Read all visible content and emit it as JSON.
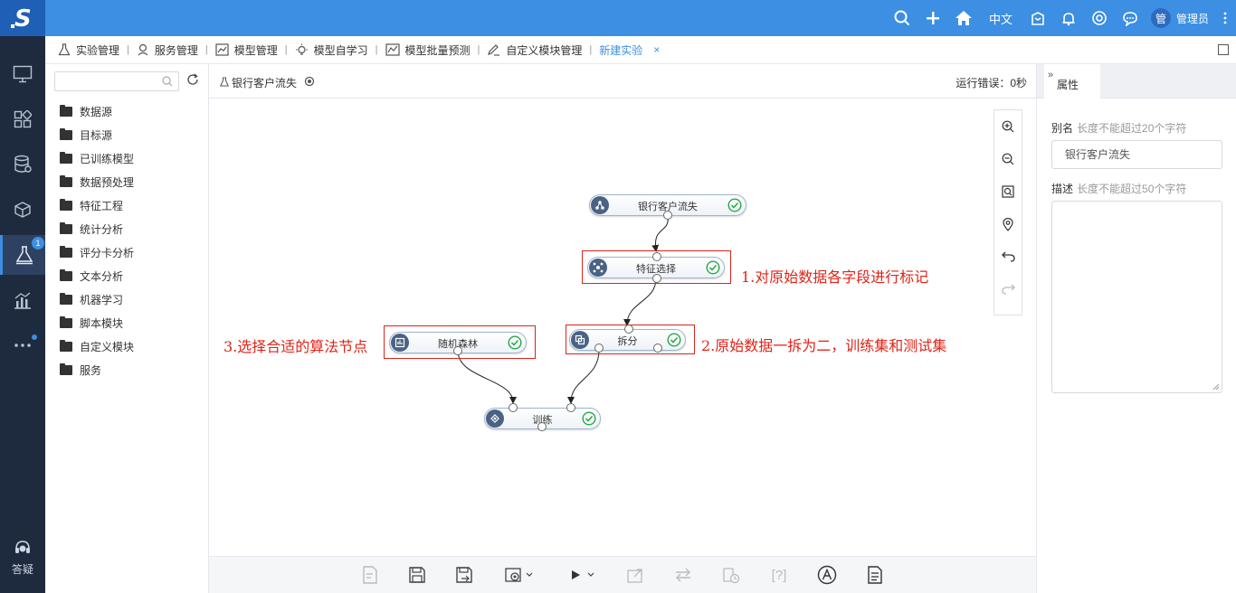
{
  "header": {
    "lang_label": "中文",
    "avatar_text": "管",
    "user_name": "管理员",
    "icons": [
      "search-icon",
      "plus-icon",
      "home-icon",
      "package-icon",
      "bell-icon",
      "life-ring-icon",
      "chat-icon",
      "more-vertical-icon"
    ]
  },
  "rail": {
    "items": [
      "monitor-icon",
      "dashboard-icon",
      "database-icon",
      "cube-icon",
      "experiment-icon",
      "chart-icon",
      "more-icon"
    ],
    "badge": "1",
    "help_label": "答疑"
  },
  "tabs": [
    {
      "label": "实验管理",
      "icon": "flask-icon"
    },
    {
      "label": "服务管理",
      "icon": "service-icon"
    },
    {
      "label": "模型管理",
      "icon": "model-icon"
    },
    {
      "label": "模型自学习",
      "icon": "bulb-icon"
    },
    {
      "label": "模型批量预测",
      "icon": "trend-icon"
    },
    {
      "label": "自定义模块管理",
      "icon": "edit-icon"
    },
    {
      "label": "新建实验",
      "icon": ""
    }
  ],
  "tab_close": "×",
  "tree": {
    "search_placeholder": "",
    "items": [
      "数据源",
      "目标源",
      "已训练模型",
      "数据预处理",
      "特征工程",
      "统计分析",
      "评分卡分析",
      "文本分析",
      "机器学习",
      "脚本模块",
      "自定义模块",
      "服务"
    ]
  },
  "canvas_header": {
    "experiment_name": "银行客户流失",
    "run_status": "运行错误：0秒"
  },
  "nodes": {
    "source": "银行客户流失",
    "feature": "特征选择",
    "split": "拆分",
    "forest": "随机森林",
    "train": "训练"
  },
  "annotations": {
    "a1": "1.对原始数据各字段进行标记",
    "a2": "2.原始数据一拆为二，训练集和测试集",
    "a3": "3.选择合适的算法节点"
  },
  "bottom_tools": [
    "doc-icon",
    "save-icon",
    "save-as-icon",
    "settings-icon",
    "run-icon",
    "export-icon",
    "swap-icon",
    "schedule-icon",
    "help-icon",
    "a-icon",
    "notes-icon"
  ],
  "bottom_help_text": "[?]",
  "properties": {
    "tab_title": "属性",
    "alias_label": "别名",
    "alias_hint": "长度不能超过20个字符",
    "alias_value": "银行客户流失",
    "desc_label": "描述",
    "desc_hint": "长度不能超过50个字符",
    "desc_value": ""
  },
  "colors": {
    "topbar": "#3c8fe2",
    "rail": "#1e2a3e",
    "annotation_red": "#e02418",
    "ok_green": "#27a845"
  }
}
